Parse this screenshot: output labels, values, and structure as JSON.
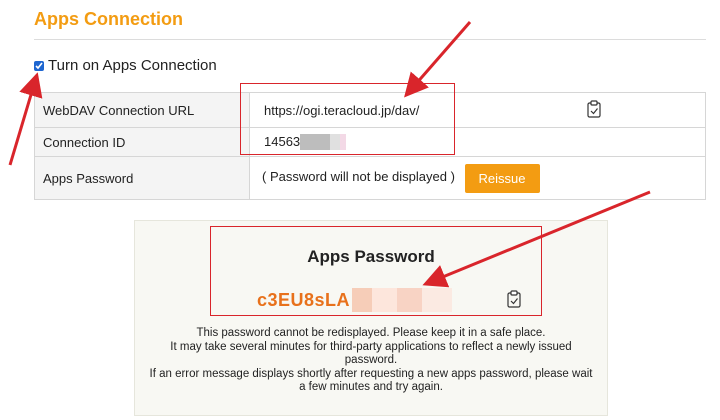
{
  "section": {
    "title": "Apps Connection"
  },
  "enable": {
    "label": "Turn on Apps Connection",
    "checked": true
  },
  "table": {
    "rows": [
      {
        "label": "WebDAV Connection URL",
        "value": "https://ogi.teracloud.jp/dav/"
      },
      {
        "label": "Connection ID",
        "value": "14563"
      },
      {
        "label": "Apps Password",
        "value": "( Password will not be displayed )"
      }
    ],
    "reissue_label": "Reissue"
  },
  "panel": {
    "heading": "Apps Password",
    "password_visible": "c3EU8sLA",
    "message_lines": [
      "This password cannot be redisplayed. Please keep it in a safe place.",
      "It may take several minutes for third-party applications to reflect a newly issued password.",
      "If an error message displays shortly after requesting a new apps password, please wait a few minutes and try again."
    ]
  },
  "colors": {
    "accent": "#f39c12",
    "password": "#e8711b",
    "annotation": "#d9252b"
  },
  "icons": {
    "copy": "clipboard-check-icon",
    "annotation_arrow": "red-arrow-icon"
  }
}
